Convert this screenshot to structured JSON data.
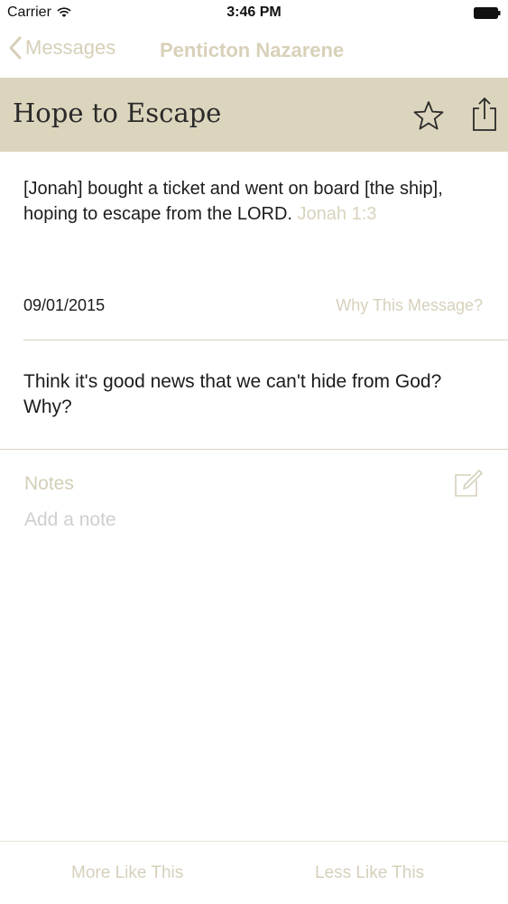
{
  "status_bar": {
    "carrier": "Carrier",
    "time": "3:46 PM"
  },
  "nav": {
    "back_label": "Messages",
    "title": "Penticton Nazarene"
  },
  "message": {
    "title": "Hope to Escape",
    "verse_text": "[Jonah] bought a ticket and went on board [the ship], hoping to escape from the LORD.",
    "verse_reference": "Jonah 1:3",
    "date": "09/01/2015",
    "why_link": "Why This Message?",
    "question": "Think it's good news that we can't hide from God? Why?"
  },
  "notes": {
    "label": "Notes",
    "placeholder": "Add a note"
  },
  "bottom_bar": {
    "more_label": "More Like This",
    "less_label": "Less Like This"
  },
  "icons": {
    "wifi": "wifi-icon",
    "battery": "battery-icon",
    "back": "chevron-left-icon",
    "star": "star-icon",
    "share": "share-icon",
    "edit": "compose-icon"
  },
  "colors": {
    "accent": "#d6cfb8",
    "header_band": "#dcd5bd",
    "muted_text": "#d6d0bb"
  }
}
